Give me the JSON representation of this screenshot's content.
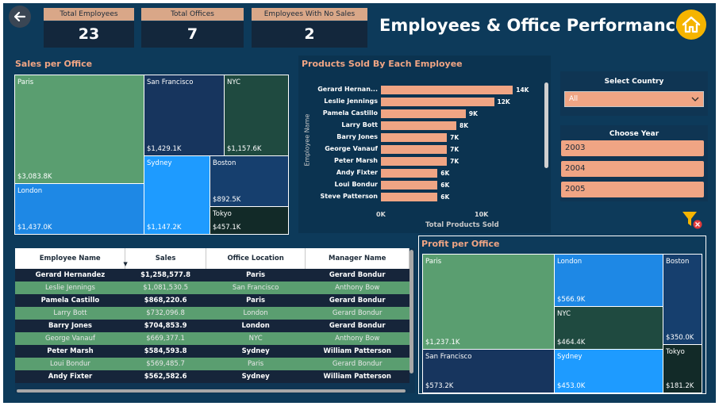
{
  "header": {
    "title": "Employees & Office Performance",
    "kpis": [
      {
        "label": "Total Employees",
        "value": "23"
      },
      {
        "label": "Total Offices",
        "value": "7"
      },
      {
        "label": "Employees With No Sales",
        "value": "2"
      }
    ]
  },
  "sales_per_office": {
    "title": "Sales per Office",
    "cells": [
      {
        "name": "Paris",
        "value": "$3,083.8K",
        "color": "#5a9e70"
      },
      {
        "name": "London",
        "value": "$1,437.0K",
        "color": "#1e88e5"
      },
      {
        "name": "San Francisco",
        "value": "$1,429.1K",
        "color": "#17355e"
      },
      {
        "name": "NYC",
        "value": "$1,157.6K",
        "color": "#1f4a40"
      },
      {
        "name": "Sydney",
        "value": "$1,147.2K",
        "color": "#1e9bff"
      },
      {
        "name": "Boston",
        "value": "$892.5K",
        "color": "#163f6e"
      },
      {
        "name": "Tokyo",
        "value": "$457.1K",
        "color": "#122a28"
      }
    ]
  },
  "products_chart": {
    "title": "Products Sold By Each Employee",
    "ylabel": "Employee Name",
    "xlabel": "Total Products Sold",
    "x_ticks": [
      "0K",
      "10K"
    ]
  },
  "chart_data": {
    "type": "bar",
    "orientation": "horizontal",
    "title": "Products Sold By Each Employee",
    "xlabel": "Total Products Sold",
    "ylabel": "Employee Name",
    "categories": [
      "Gerard Hernan...",
      "Leslie Jennings",
      "Pamela Castillo",
      "Larry Bott",
      "Barry Jones",
      "George Vanauf",
      "Peter Marsh",
      "Andy Fixter",
      "Loui Bondur",
      "Steve Patterson"
    ],
    "values": [
      14,
      12,
      9,
      8,
      7,
      7,
      7,
      6,
      6,
      6
    ],
    "data_labels": [
      "14K",
      "12K",
      "9K",
      "8K",
      "7K",
      "7K",
      "7K",
      "6K",
      "6K",
      "6K"
    ],
    "xlim": [
      0,
      16
    ],
    "unit": "K"
  },
  "country_filter": {
    "title": "Select Country",
    "selected": "All"
  },
  "year_filter": {
    "title": "Choose Year",
    "years": [
      "2003",
      "2004",
      "2005"
    ]
  },
  "employee_table": {
    "columns": [
      "Employee Name",
      "Sales",
      "Office Location",
      "Manager Name"
    ],
    "rows": [
      [
        "Gerard Hernandez",
        "$1,258,577.8",
        "Paris",
        "Gerard Bondur"
      ],
      [
        "Leslie Jennings",
        "$1,081,530.5",
        "San Francisco",
        "Anthony Bow"
      ],
      [
        "Pamela Castillo",
        "$868,220.6",
        "Paris",
        "Gerard Bondur"
      ],
      [
        "Larry Bott",
        "$732,096.8",
        "London",
        "Gerard Bondur"
      ],
      [
        "Barry Jones",
        "$704,853.9",
        "London",
        "Gerard Bondur"
      ],
      [
        "George Vanauf",
        "$669,377.1",
        "NYC",
        "Anthony Bow"
      ],
      [
        "Peter Marsh",
        "$584,593.8",
        "Sydney",
        "William Patterson"
      ],
      [
        "Loui Bondur",
        "$569,485.7",
        "Paris",
        "Gerard Bondur"
      ],
      [
        "Andy Fixter",
        "$562,582.6",
        "Sydney",
        "William Patterson"
      ]
    ]
  },
  "profit_per_office": {
    "title": "Profit per Office",
    "cells": [
      {
        "name": "Paris",
        "value": "$1,237.1K",
        "color": "#5a9e70"
      },
      {
        "name": "San Francisco",
        "value": "$573.2K",
        "color": "#17355e"
      },
      {
        "name": "London",
        "value": "$566.9K",
        "color": "#1e88e5"
      },
      {
        "name": "NYC",
        "value": "$464.4K",
        "color": "#1f4a40"
      },
      {
        "name": "Sydney",
        "value": "$453.0K",
        "color": "#1e9bff"
      },
      {
        "name": "Boston",
        "value": "$350.0K",
        "color": "#163f6e"
      },
      {
        "name": "Tokyo",
        "value": "$181.2K",
        "color": "#122a28"
      }
    ]
  }
}
